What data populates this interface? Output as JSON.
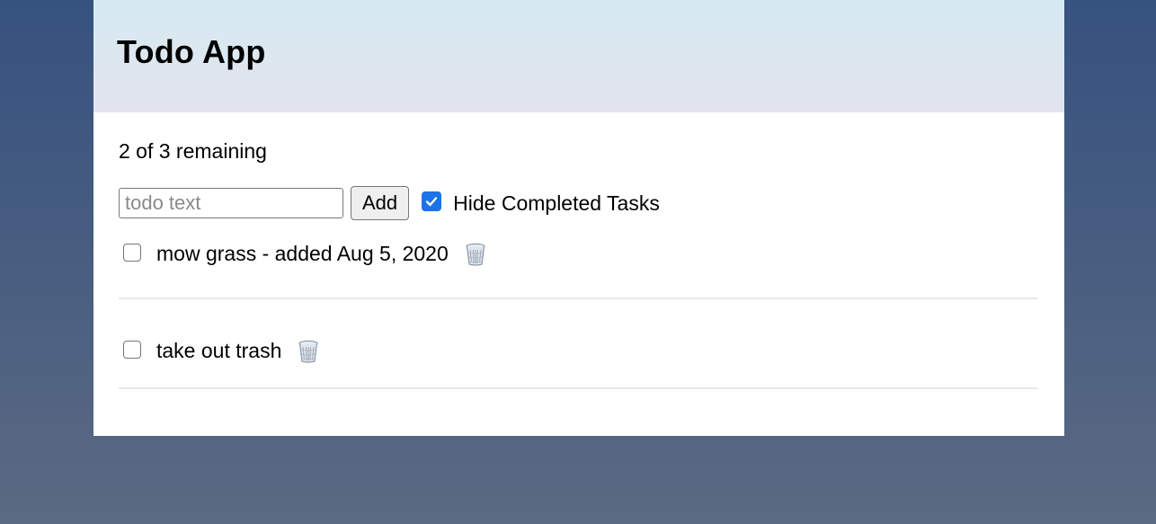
{
  "header": {
    "title": "Todo App"
  },
  "status": {
    "remaining_text": "2 of 3 remaining"
  },
  "controls": {
    "input_placeholder": "todo text",
    "input_value": "",
    "add_label": "Add",
    "hide_completed_label": "Hide Completed Tasks",
    "hide_completed_checked": true
  },
  "todos": [
    {
      "text": "mow grass - added Aug 5, 2020",
      "checked": false,
      "delete_icon": "trash-icon"
    },
    {
      "text": "take out trash",
      "checked": false,
      "delete_icon": "trash-icon"
    }
  ],
  "colors": {
    "background_top": "#36527f",
    "background_bottom": "#5b6a82",
    "header_bg": "#d6eaf2",
    "checkbox_accent": "#1a73e8"
  }
}
